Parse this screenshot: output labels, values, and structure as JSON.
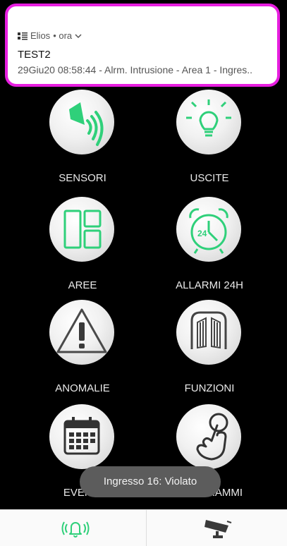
{
  "notification": {
    "app_name": "Elios",
    "meta": "• ora",
    "title": "TEST2",
    "body": "29Giu20 08:58:44 - Alrm. Intrusione - Area 1 - Ingres.."
  },
  "tiles": [
    {
      "label": "SENSORI",
      "icon": "sensor-icon"
    },
    {
      "label": "USCITE",
      "icon": "lightbulb-icon"
    },
    {
      "label": "AREE",
      "icon": "areas-icon"
    },
    {
      "label": "ALLARMI 24H",
      "icon": "alarm-clock-icon"
    },
    {
      "label": "ANOMALIE",
      "icon": "warning-icon"
    },
    {
      "label": "FUNZIONI",
      "icon": "gate-icon"
    },
    {
      "label": "EVENTI",
      "icon": "calendar-icon"
    },
    {
      "label": "PROGRAMMI",
      "icon": "touch-icon"
    }
  ],
  "toast": "Ingresso 16: Violato",
  "bottom_bar": [
    {
      "icon": "alarm-bell-icon"
    },
    {
      "icon": "cctv-camera-icon"
    }
  ],
  "colors": {
    "accent_green": "#2fd07a",
    "notification_border": "#e81ee0",
    "background": "#000000"
  }
}
